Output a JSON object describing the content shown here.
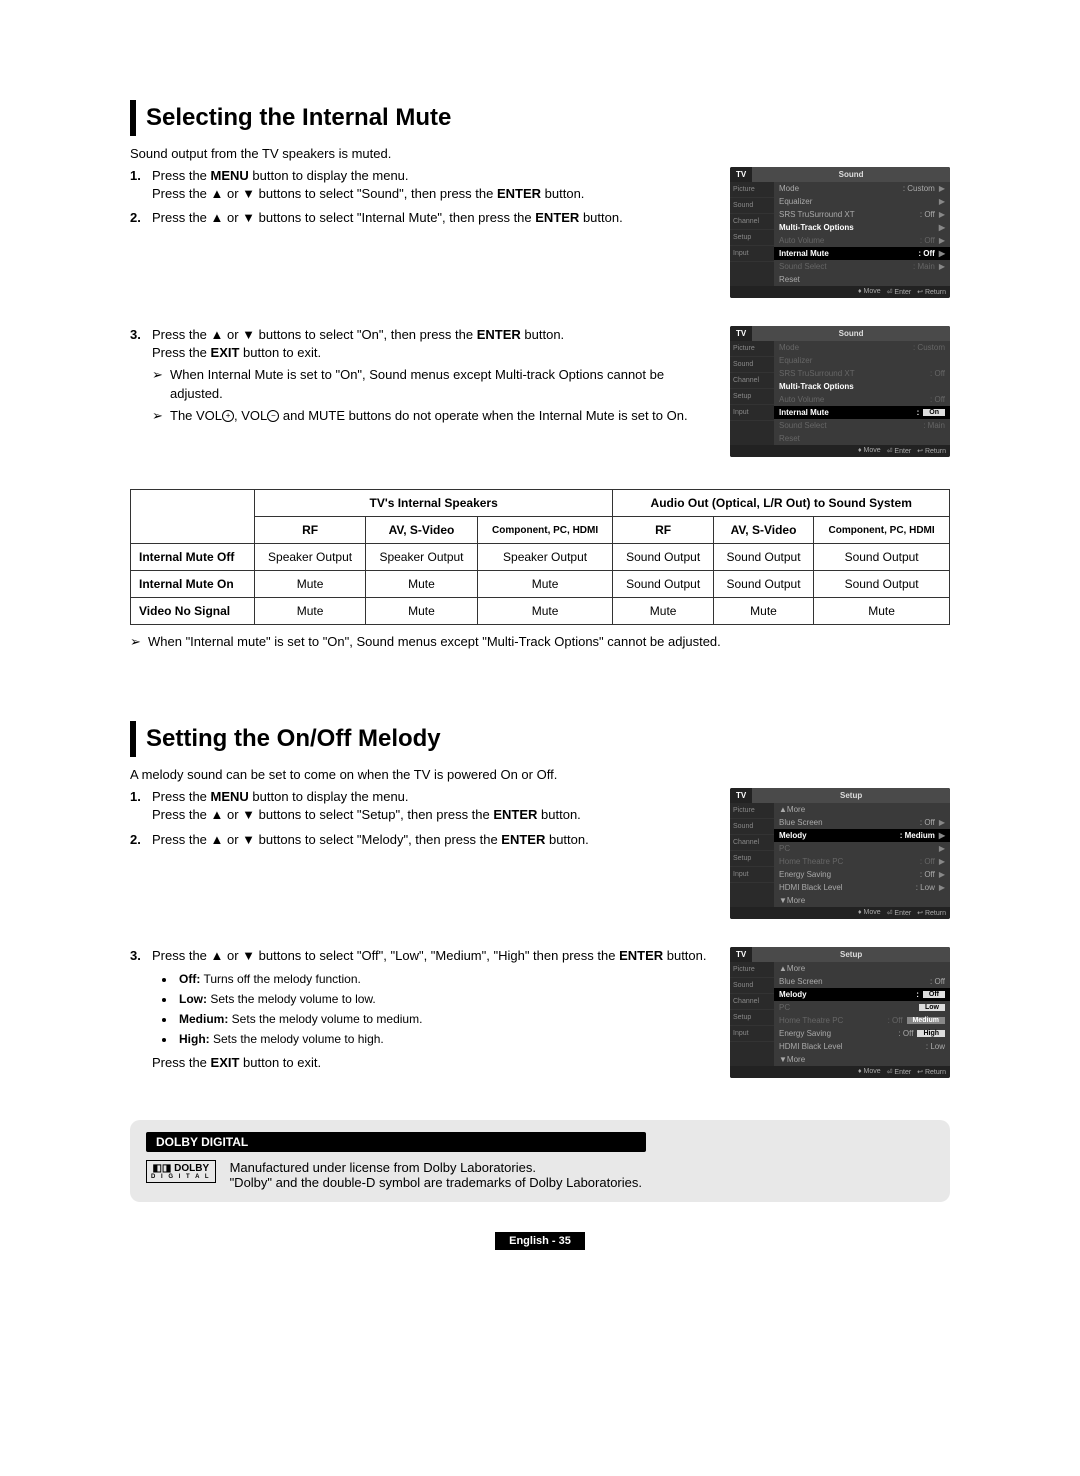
{
  "section1": {
    "title": "Selecting the Internal Mute",
    "intro": "Sound output from the TV speakers is muted.",
    "step1a": "Press the MENU button to display the menu.",
    "step1b": "Press the ▲ or ▼ buttons to select \"Sound\", then press the ENTER button.",
    "step2": "Press the ▲ or ▼ buttons to select \"Internal Mute\", then press the ENTER button.",
    "step3a": "Press the ▲ or ▼ buttons to select \"On\", then press the ENTER button.",
    "step3b": "Press the EXIT button to exit.",
    "note1": "When Internal Mute is set to \"On\", Sound menus except Multi-track Options cannot be adjusted.",
    "note2": "The VOL⊕, VOL⊖ and MUTE buttons do not operate when the Internal Mute is set to On.",
    "tableNote": "When \"Internal mute\" is set to \"On\", Sound menus except \"Multi-Track Options\" cannot be adjusted."
  },
  "osd1": {
    "hl": "TV",
    "hr": "Sound",
    "side": [
      "Picture",
      "Sound",
      "Channel",
      "Setup",
      "Input"
    ],
    "rows": [
      {
        "l": "Mode",
        "v": ": Custom",
        "arrow": "▶"
      },
      {
        "l": "Equalizer",
        "v": "",
        "arrow": "▶"
      },
      {
        "l": "SRS TruSurround XT",
        "v": ": Off",
        "arrow": "▶"
      },
      {
        "l": "Multi-Track Options",
        "v": "",
        "arrow": "▶",
        "bold": true
      },
      {
        "l": "Auto Volume",
        "v": ": Off",
        "arrow": "▶",
        "dim": true
      },
      {
        "l": "Internal Mute",
        "v": ": Off",
        "arrow": "▶",
        "hl": true
      },
      {
        "l": "Sound Select",
        "v": ": Main",
        "arrow": "▶",
        "dim": true
      },
      {
        "l": "Reset",
        "v": "",
        "arrow": ""
      }
    ],
    "footer": [
      "♦ Move",
      "⏎ Enter",
      "↩ Return"
    ]
  },
  "osd2": {
    "hl": "TV",
    "hr": "Sound",
    "side": [
      "Picture",
      "Sound",
      "Channel",
      "Setup",
      "Input"
    ],
    "rows": [
      {
        "l": "Mode",
        "v": ": Custom",
        "dim": true
      },
      {
        "l": "Equalizer",
        "v": "",
        "dim": true
      },
      {
        "l": "SRS TruSurround XT",
        "v": ": Off",
        "dim": true
      },
      {
        "l": "Multi-Track Options",
        "v": "",
        "bold": true
      },
      {
        "l": "Auto Volume",
        "v": ": Off",
        "dim": true
      },
      {
        "l": "Internal Mute",
        "v": ":",
        "hl": true,
        "box": "On"
      },
      {
        "l": "Sound Select",
        "v": ": Main",
        "dim": true
      },
      {
        "l": "Reset",
        "v": "",
        "dim": true
      }
    ],
    "footer": [
      "♦ Move",
      "⏎ Enter",
      "↩ Return"
    ]
  },
  "table": {
    "h1": "TV's Internal Speakers",
    "h2": "Audio Out (Optical, L/R Out) to Sound System",
    "sub": [
      "RF",
      "AV, S-Video",
      "Component, PC, HDMI",
      "RF",
      "AV, S-Video",
      "Component, PC, HDMI"
    ],
    "rows": [
      {
        "label": "Internal Mute Off",
        "cells": [
          "Speaker Output",
          "Speaker Output",
          "Speaker Output",
          "Sound Output",
          "Sound Output",
          "Sound Output"
        ]
      },
      {
        "label": "Internal Mute On",
        "cells": [
          "Mute",
          "Mute",
          "Mute",
          "Sound Output",
          "Sound Output",
          "Sound Output"
        ]
      },
      {
        "label": "Video No Signal",
        "cells": [
          "Mute",
          "Mute",
          "Mute",
          "Mute",
          "Mute",
          "Mute"
        ]
      }
    ]
  },
  "section2": {
    "title": "Setting the On/Off Melody",
    "intro": "A melody sound can be set to come on when the TV is powered On or Off.",
    "step1a": "Press the MENU button to display the menu.",
    "step1b": "Press the ▲ or ▼ buttons to select \"Setup\", then press the ENTER button.",
    "step2": "Press the ▲ or ▼ buttons to select \"Melody\", then press the ENTER button.",
    "step3a": "Press the ▲ or ▼ buttons to select \"Off\", \"Low\", \"Medium\", \"High\" then press the ENTER button.",
    "bullets": [
      {
        "b": "Off:",
        "t": " Turns off the melody function."
      },
      {
        "b": "Low:",
        "t": " Sets the melody volume to low."
      },
      {
        "b": "Medium:",
        "t": " Sets the melody volume to medium."
      },
      {
        "b": "High:",
        "t": " Sets the melody volume to high."
      }
    ],
    "step3b": "Press the EXIT button to exit."
  },
  "osd3": {
    "hl": "TV",
    "hr": "Setup",
    "side": [
      "Picture",
      "Sound",
      "Channel",
      "Setup",
      "Input"
    ],
    "rows": [
      {
        "l": "▲More",
        "v": ""
      },
      {
        "l": "Blue Screen",
        "v": ": Off",
        "arrow": "▶"
      },
      {
        "l": "Melody",
        "v": ": Medium",
        "arrow": "▶",
        "hl": true
      },
      {
        "l": "PC",
        "v": "",
        "arrow": "▶",
        "dim": true
      },
      {
        "l": "Home Theatre PC",
        "v": ": Off",
        "arrow": "▶",
        "dim": true
      },
      {
        "l": "Energy Saving",
        "v": ": Off",
        "arrow": "▶"
      },
      {
        "l": "HDMI Black Level",
        "v": ": Low",
        "arrow": "▶"
      },
      {
        "l": "▼More",
        "v": ""
      }
    ],
    "footer": [
      "♦ Move",
      "⏎ Enter",
      "↩ Return"
    ]
  },
  "osd4": {
    "hl": "TV",
    "hr": "Setup",
    "side": [
      "Picture",
      "Sound",
      "Channel",
      "Setup",
      "Input"
    ],
    "rows": [
      {
        "l": "▲More",
        "v": ""
      },
      {
        "l": "Blue Screen",
        "v": ": Off"
      },
      {
        "l": "Melody",
        "v": ":",
        "hl": true,
        "box": "Off"
      },
      {
        "l": "PC",
        "v": "",
        "box": "Low",
        "dim": true
      },
      {
        "l": "Home Theatre PC",
        "v": ": Off",
        "box": "Medium",
        "boxhl": true,
        "dim": true
      },
      {
        "l": "Energy Saving",
        "v": ": Off",
        "box": "High"
      },
      {
        "l": "HDMI Black Level",
        "v": ": Low"
      },
      {
        "l": "▼More",
        "v": ""
      }
    ],
    "footer": [
      "♦ Move",
      "⏎ Enter",
      "↩ Return"
    ]
  },
  "dolby": {
    "pill": "DOLBY DIGITAL",
    "line1": "Manufactured under license from Dolby Laboratories.",
    "line2": "\"Dolby\" and the double-D symbol are trademarks of Dolby Laboratories.",
    "logo1": "DOLBY",
    "logo2": "D I G I T A L"
  },
  "page": "English - 35"
}
